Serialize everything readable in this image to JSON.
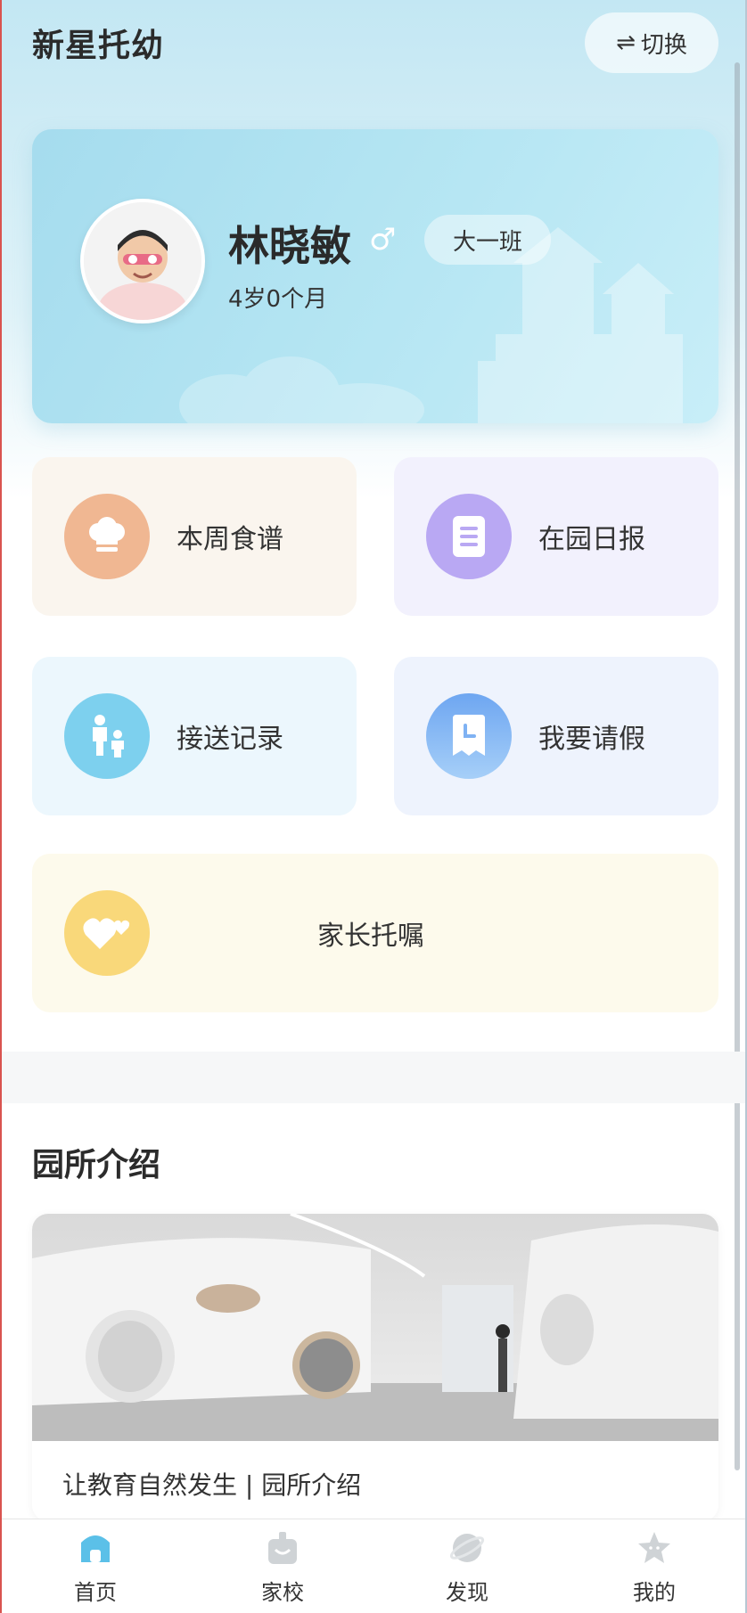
{
  "header": {
    "app_title": "新星托幼",
    "switch_icon": "⇌",
    "switch_label": "切换"
  },
  "profile": {
    "name": "林晓敏",
    "gender_icon": "♂",
    "class_name": "大一班",
    "age": "4岁0个月"
  },
  "functions": [
    {
      "label": "本周食谱",
      "icon": "chef-hat-icon",
      "color": "#f0b792"
    },
    {
      "label": "在园日报",
      "icon": "document-icon",
      "color": "#b9a8f3"
    },
    {
      "label": "接送记录",
      "icon": "parent-child-icon",
      "color": "#7dd0ee"
    },
    {
      "label": "我要请假",
      "icon": "leave-clock-icon",
      "color": "#7fb2f3"
    },
    {
      "label": "家长托嘱",
      "icon": "hearts-icon",
      "color": "#f9d87a"
    }
  ],
  "intro": {
    "section_title": "园所介绍",
    "caption": "让教育自然发生 | 园所介绍"
  },
  "bottom_nav": [
    {
      "label": "首页",
      "icon": "home-icon",
      "active": true
    },
    {
      "label": "家校",
      "icon": "school-bag-icon",
      "active": false
    },
    {
      "label": "发现",
      "icon": "planet-icon",
      "active": false
    },
    {
      "label": "我的",
      "icon": "star-face-icon",
      "active": false
    }
  ],
  "colors": {
    "active_nav": "#5bc0e8",
    "inactive_nav": "#cfd3d6",
    "card_blue": "#a5dcee"
  }
}
